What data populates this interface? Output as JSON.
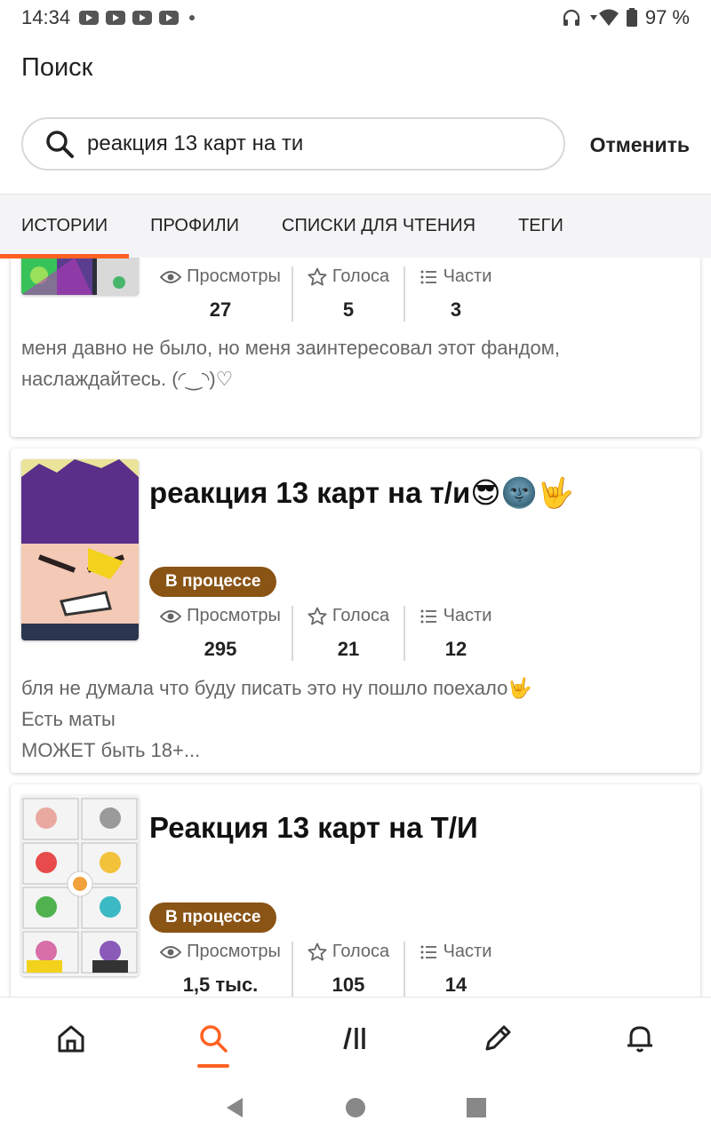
{
  "status_bar": {
    "time": "14:34",
    "battery": "97 %"
  },
  "header": {
    "title": "Поиск",
    "cancel_label": "Отменить"
  },
  "search": {
    "value": "реакция 13 карт на ти"
  },
  "tabs": [
    {
      "label": "ИСТОРИИ",
      "active": true
    },
    {
      "label": "ПРОФИЛИ"
    },
    {
      "label": "СПИСКИ ДЛЯ ЧТЕНИЯ"
    },
    {
      "label": "ТЕГИ"
    }
  ],
  "stat_labels": {
    "views": "Просмотры",
    "votes": "Голоса",
    "parts": "Части"
  },
  "stories": [
    {
      "views": "27",
      "votes": "5",
      "parts": "3",
      "description": [
        "меня давно не было, но меня заинтересовал этот фандом,",
        "наслаждайтесь. (◜‿◝)♡"
      ]
    },
    {
      "title": "реакция 13 карт на т/и😎🌚🤟",
      "status": "В процессе",
      "views": "295",
      "votes": "21",
      "parts": "12",
      "description": [
        "бля не думала что буду писать это ну пошло поехало🤟",
        "Есть маты",
        "МОЖЕТ быть 18+..."
      ]
    },
    {
      "title": "Реакция 13 карт на Т/И",
      "status": "В процессе",
      "views": "1,5 тыс.",
      "votes": "105",
      "parts": "14"
    }
  ],
  "colors": {
    "accent": "#ff6122",
    "badge": "#8a5415"
  }
}
